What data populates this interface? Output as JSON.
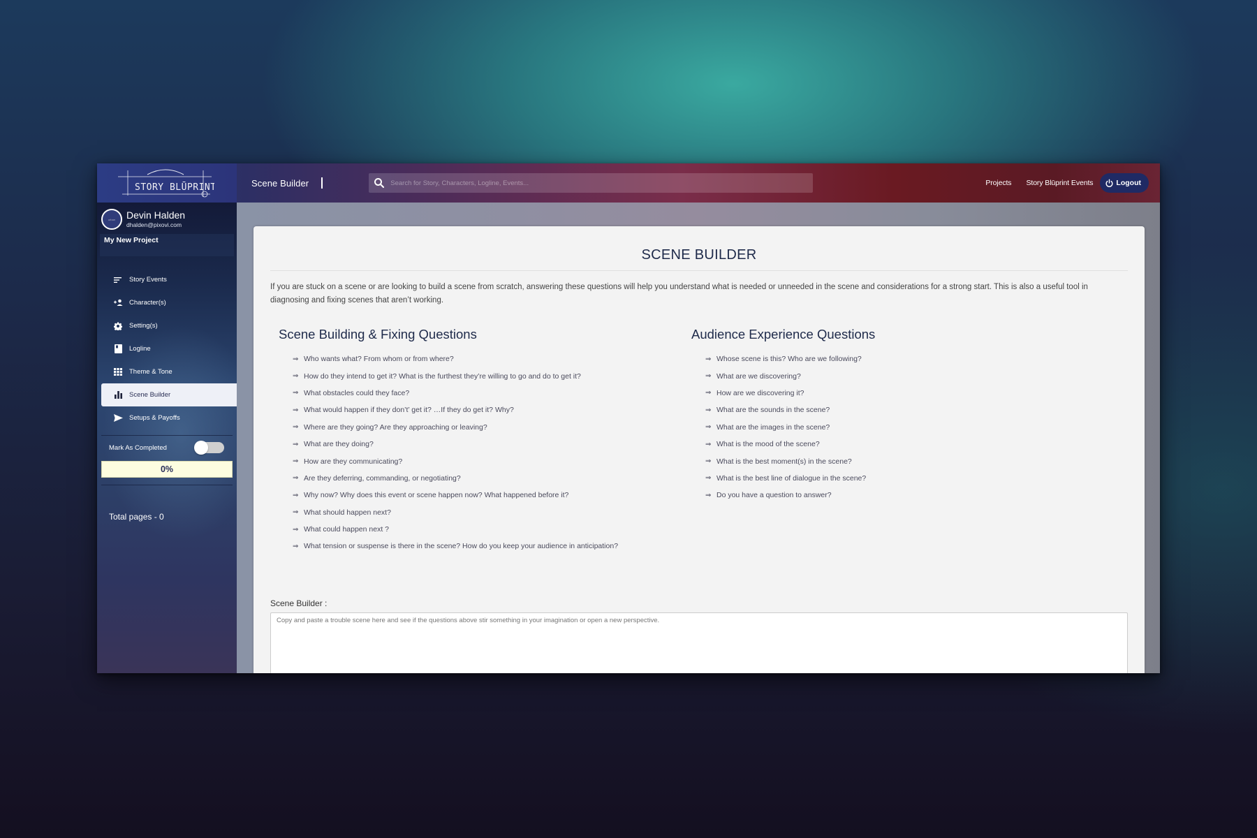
{
  "header": {
    "logo_text": "STORY BLŪPRINT",
    "page_name": "Scene Builder",
    "search_placeholder": "Search for Story, Characters, Logline, Events...",
    "nav_links": [
      "Projects",
      "Story Blūprint Events"
    ],
    "logout_label": "Logout"
  },
  "sidebar": {
    "user_name": "Devin Halden",
    "user_email": "dhalden@pixovi.com",
    "avatar_text": "urban",
    "project_name": "My New Project",
    "items": [
      {
        "label": "Story Events",
        "icon": "sort-lines-icon"
      },
      {
        "label": "Character(s)",
        "icon": "add-person-icon"
      },
      {
        "label": "Setting(s)",
        "icon": "gear-icon"
      },
      {
        "label": "Logline",
        "icon": "book-icon"
      },
      {
        "label": "Theme & Tone",
        "icon": "grid-icon"
      },
      {
        "label": "Scene Builder",
        "icon": "bar-chart-icon",
        "active": true
      },
      {
        "label": "Setups & Payoffs",
        "icon": "send-icon"
      }
    ],
    "mark_completed_label": "Mark As Completed",
    "mark_completed_on": false,
    "progress_text": "0%",
    "progress_value": 0,
    "total_pages_text": "Total pages - 0"
  },
  "main": {
    "title": "SCENE BUILDER",
    "intro": "If you are stuck on a scene or are looking to build a scene from scratch, answering these questions will help you understand what is needed or unneeded in the scene and considerations for a strong start. This is also a useful tool in diagnosing and fixing scenes that aren’t working.",
    "bullet": "⇒",
    "left_heading": "Scene Building & Fixing Questions",
    "left_questions": [
      "Who wants what? From whom or from where?",
      "How do they intend to get it? What is the furthest they’re willing to go and do to get it?",
      "What obstacles could they face?",
      "What would happen if they don’t’ get it? …If they do get it? Why?",
      "Where are they going? Are they approaching or leaving?",
      "What are they doing?",
      "How are they communicating?",
      "Are they deferring, commanding, or negotiating?",
      "Why now? Why does this event or scene happen now? What happened before it?",
      "What should happen next?",
      "What could happen next ?",
      "What tension or suspense is there in the scene? How do you keep your audience in anticipation?"
    ],
    "right_heading": "Audience Experience Questions",
    "right_questions": [
      "Whose scene is this? Who are we following?",
      "What are we discovering?",
      "How are we discovering it?",
      "What are the sounds in the scene?",
      "What are the images in the scene?",
      "What is the mood of the scene?",
      "What is the best moment(s) in the scene?",
      "What is the best line of dialogue in the scene?",
      "Do you have a question to answer?"
    ],
    "scene_builder_label": "Scene Builder :",
    "scene_builder_placeholder": "Copy and paste a trouble scene here and see if the questions above stir something in your imagination or open a new perspective.",
    "scene_builder_value": ""
  }
}
